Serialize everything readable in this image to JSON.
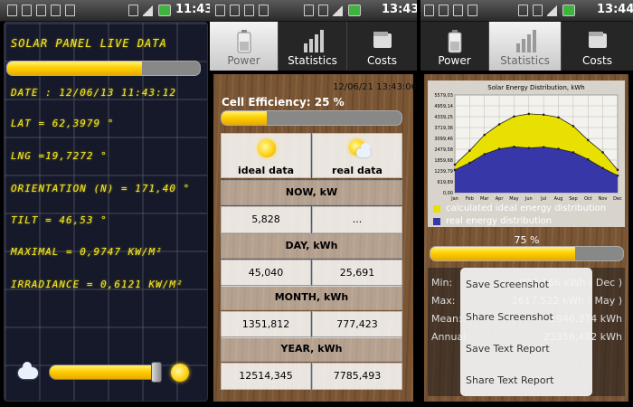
{
  "screen1": {
    "time": "11:43",
    "title": "SOLAR PANEL LIVE DATA",
    "progress": 0.7,
    "lines": [
      "DATE : 12/06/13 11:43:12",
      "LAT = 62,3979 °",
      "LNG =19,7272 °",
      "ORIENTATION (N) = 171,40 °",
      "TILT = 46,53 °",
      "MAXIMAL = 0,9747 KW/M²",
      "IRRADIANCE = 0,6121 KW/M²"
    ],
    "slider_level": 0.95
  },
  "screen2": {
    "time": "13:43",
    "tabs": [
      "Power",
      "Statistics",
      "Costs"
    ],
    "active_tab": "Power",
    "timestamp": "12/06/21 13:43:06",
    "efficiency_label": "Cell Efficiency: 25 %",
    "efficiency": 0.25,
    "col_ideal": "ideal data",
    "col_real": "real data",
    "rows": [
      {
        "header": "NOW, kW",
        "ideal": "5,828",
        "real": "..."
      },
      {
        "header": "DAY, kWh",
        "ideal": "45,040",
        "real": "25,691"
      },
      {
        "header": "MONTH, kWh",
        "ideal": "1351,812",
        "real": "777,423"
      },
      {
        "header": "YEAR, kWh",
        "ideal": "12514,345",
        "real": "7785,493"
      }
    ]
  },
  "screen3": {
    "time": "13:44",
    "tabs": [
      "Power",
      "Statistics",
      "Costs"
    ],
    "active_tab": "Statistics",
    "progress_label": "75 %",
    "progress": 0.75,
    "legend": [
      "calculated ideal energy distribution",
      "real energy distribution"
    ],
    "stats": [
      {
        "label": "Min:",
        "value": "974,166 kWh ( Dec )"
      },
      {
        "label": "Max:",
        "value": "2617,522 kWh ( May )"
      },
      {
        "label": "Mean:",
        "value": "1946,374 kWh"
      },
      {
        "label": "Annual:",
        "value": "23356,482 kWh"
      }
    ],
    "menu": [
      "Save Screenshot",
      "Share Screenshot",
      "Save Text Report",
      "Share Text Report"
    ]
  },
  "chart_data": {
    "type": "area",
    "title": "Solar Energy Distribution, kWh",
    "categories": [
      "Jan",
      "Feb",
      "Mar",
      "Apr",
      "May",
      "Jun",
      "Jul",
      "Aug",
      "Sep",
      "Oct",
      "Nov",
      "Dec"
    ],
    "ytick_labels": [
      "0,00",
      "619,89",
      "1239,79",
      "1859,68",
      "2479,58",
      "3099,46",
      "3719,36",
      "4339,25",
      "4959,14",
      "5579,03"
    ],
    "ylim": [
      0,
      5579.03
    ],
    "series": [
      {
        "name": "calculated ideal energy distribution",
        "color": "#e8e000",
        "values": [
          1600,
          2400,
          3300,
          3900,
          4350,
          4500,
          4450,
          4300,
          3800,
          3000,
          2300,
          1300
        ]
      },
      {
        "name": "real energy distribution",
        "color": "#3737a8",
        "values": [
          1300,
          1700,
          2200,
          2500,
          2617.5,
          2550,
          2600,
          2500,
          2300,
          1900,
          1400,
          974.2
        ]
      }
    ],
    "grid": true,
    "legend_position": "bottom"
  },
  "colors": {
    "lcd_yellow": "#f3e62a",
    "accent_yellow": "#ffd000",
    "ideal_series": "#e8e000",
    "real_series": "#3737a8"
  }
}
